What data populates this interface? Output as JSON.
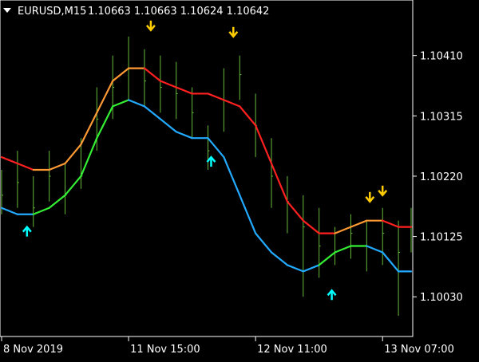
{
  "header": {
    "symbol_timeframe": "EURUSD,M15",
    "ohlc": "1.10663 1.10663 1.10624 1.10642",
    "menu_icon": "triangle-down-icon"
  },
  "colors": {
    "background": "#000000",
    "axis": "#ffffff",
    "price_bars": "#66bb3a",
    "upper_band_rising": "#ff9933",
    "upper_band_falling": "#ff2020",
    "lower_band_rising": "#33ee33",
    "lower_band_falling": "#22aaff",
    "sell_arrow": "#ffcc00",
    "buy_arrow": "#00ffff",
    "text": "#ffffff"
  },
  "chart_data": {
    "type": "line",
    "symbol": "EURUSD",
    "timeframe": "M15",
    "x_tick_labels": [
      "8 Nov 2019",
      "11 Nov 15:00",
      "12 Nov 11:00",
      "13 Nov 07:00"
    ],
    "x_tick_index": [
      0,
      40,
      80,
      120
    ],
    "y_tick_labels": [
      "1.10410",
      "1.10315",
      "1.10220",
      "1.10125",
      "1.10030"
    ],
    "y_ticks": [
      1.1041,
      1.10315,
      1.1022,
      1.10125,
      1.1003
    ],
    "ylim": [
      1.0997,
      1.10495
    ],
    "xlim": [
      0,
      129
    ],
    "series": [
      {
        "role": "price",
        "style": "bars",
        "points": [
          [
            0,
            1.1019,
            1.1023,
            1.1016
          ],
          [
            5,
            1.1021,
            1.1026,
            1.1017
          ],
          [
            10,
            1.1017,
            1.1022,
            1.1014
          ],
          [
            15,
            1.1022,
            1.1026,
            1.1018
          ],
          [
            20,
            1.1019,
            1.1024,
            1.1016
          ],
          [
            25,
            1.1022,
            1.1028,
            1.102
          ],
          [
            30,
            1.1031,
            1.1036,
            1.1026
          ],
          [
            35,
            1.1036,
            1.1041,
            1.1031
          ],
          [
            40,
            1.1039,
            1.1044,
            1.1034
          ],
          [
            45,
            1.1037,
            1.1042,
            1.1033
          ],
          [
            50,
            1.1036,
            1.1041,
            1.1032
          ],
          [
            55,
            1.1035,
            1.104,
            1.1031
          ],
          [
            60,
            1.1032,
            1.1036,
            1.1028
          ],
          [
            65,
            1.1026,
            1.103,
            1.1023
          ],
          [
            70,
            1.1034,
            1.1039,
            1.1029
          ],
          [
            75,
            1.1038,
            1.1041,
            1.1034
          ],
          [
            80,
            1.103,
            1.1035,
            1.1025
          ],
          [
            85,
            1.1022,
            1.1028,
            1.1017
          ],
          [
            90,
            1.1018,
            1.1022,
            1.1013
          ],
          [
            95,
            1.1014,
            1.1019,
            1.1003
          ],
          [
            100,
            1.1011,
            1.1017,
            1.1006
          ],
          [
            105,
            1.101,
            1.1014,
            1.1008
          ],
          [
            110,
            1.1013,
            1.1016,
            1.1009
          ],
          [
            115,
            1.1011,
            1.1015,
            1.1007
          ],
          [
            120,
            1.1013,
            1.1017,
            1.1008
          ],
          [
            125,
            1.101,
            1.1015,
            1.1
          ],
          [
            129,
            1.1014,
            1.1017,
            1.101
          ]
        ]
      },
      {
        "role": "upper_band",
        "points": [
          [
            0,
            1.1025
          ],
          [
            5,
            1.1024
          ],
          [
            10,
            1.1023
          ],
          [
            15,
            1.1023
          ],
          [
            20,
            1.1024
          ],
          [
            25,
            1.1027
          ],
          [
            30,
            1.1032
          ],
          [
            35,
            1.1037
          ],
          [
            40,
            1.1039
          ],
          [
            45,
            1.1039
          ],
          [
            50,
            1.1037
          ],
          [
            55,
            1.1036
          ],
          [
            60,
            1.1035
          ],
          [
            65,
            1.1035
          ],
          [
            70,
            1.1034
          ],
          [
            75,
            1.1033
          ],
          [
            80,
            1.103
          ],
          [
            85,
            1.1024
          ],
          [
            90,
            1.1018
          ],
          [
            95,
            1.1015
          ],
          [
            100,
            1.1013
          ],
          [
            105,
            1.1013
          ],
          [
            110,
            1.1014
          ],
          [
            115,
            1.1015
          ],
          [
            120,
            1.1015
          ],
          [
            125,
            1.1014
          ],
          [
            129,
            1.1014
          ]
        ],
        "colors_by_segment": [
          "falling",
          "falling",
          "rising",
          "rising",
          "rising",
          "rising",
          "rising",
          "rising",
          "rising",
          "falling",
          "falling",
          "falling",
          "falling",
          "falling",
          "falling",
          "falling",
          "falling",
          "falling",
          "falling",
          "falling",
          "falling",
          "rising",
          "rising",
          "rising",
          "falling",
          "falling"
        ]
      },
      {
        "role": "lower_band",
        "points": [
          [
            0,
            1.1017
          ],
          [
            5,
            1.1016
          ],
          [
            10,
            1.1016
          ],
          [
            15,
            1.1017
          ],
          [
            20,
            1.1019
          ],
          [
            25,
            1.1022
          ],
          [
            30,
            1.1028
          ],
          [
            35,
            1.1033
          ],
          [
            40,
            1.1034
          ],
          [
            45,
            1.1033
          ],
          [
            50,
            1.1031
          ],
          [
            55,
            1.1029
          ],
          [
            60,
            1.1028
          ],
          [
            65,
            1.1028
          ],
          [
            70,
            1.1025
          ],
          [
            75,
            1.1019
          ],
          [
            80,
            1.1013
          ],
          [
            85,
            1.101
          ],
          [
            90,
            1.1008
          ],
          [
            95,
            1.1007
          ],
          [
            100,
            1.1008
          ],
          [
            105,
            1.101
          ],
          [
            110,
            1.1011
          ],
          [
            115,
            1.1011
          ],
          [
            120,
            1.101
          ],
          [
            125,
            1.1007
          ],
          [
            129,
            1.1007
          ]
        ],
        "colors_by_segment": [
          "falling",
          "falling",
          "rising",
          "rising",
          "rising",
          "rising",
          "rising",
          "rising",
          "falling",
          "falling",
          "falling",
          "falling",
          "falling",
          "falling",
          "falling",
          "falling",
          "falling",
          "falling",
          "falling",
          "falling",
          "rising",
          "rising",
          "rising",
          "falling",
          "falling",
          "falling"
        ]
      }
    ],
    "sell_arrows": [
      [
        47,
        1.1045
      ],
      [
        73,
        1.1044
      ],
      [
        116,
        1.1018
      ],
      [
        120,
        1.1019
      ]
    ],
    "buy_arrows": [
      [
        8,
        1.1014
      ],
      [
        66,
        1.1025
      ],
      [
        104,
        1.1004
      ]
    ]
  }
}
